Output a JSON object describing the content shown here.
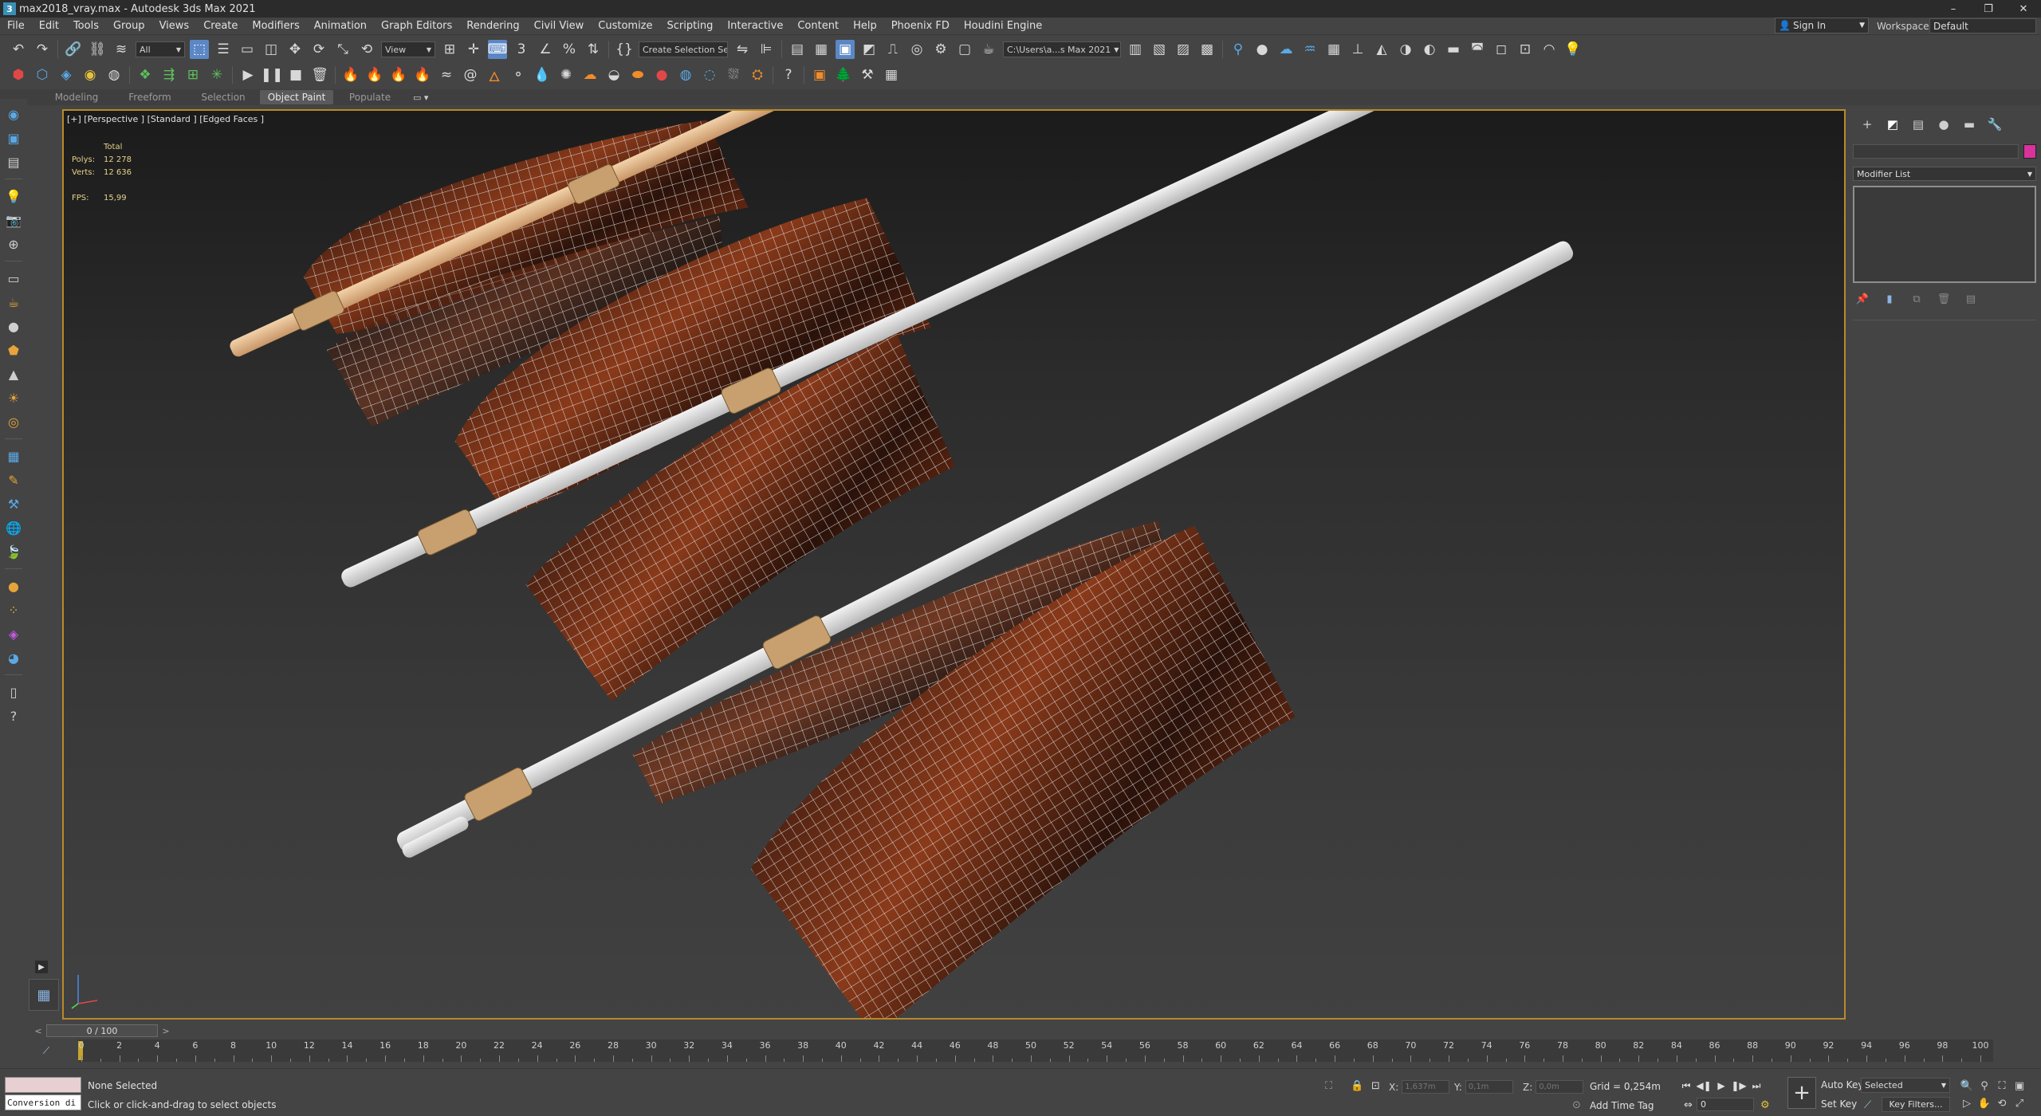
{
  "window": {
    "title": "max2018_vray.max - Autodesk 3ds Max 2021",
    "app_icon": "3",
    "controls": [
      "–",
      "❐",
      "✕"
    ]
  },
  "menu": [
    "File",
    "Edit",
    "Tools",
    "Group",
    "Views",
    "Create",
    "Modifiers",
    "Animation",
    "Graph Editors",
    "Rendering",
    "Civil View",
    "Customize",
    "Scripting",
    "Interactive",
    "Content",
    "Help",
    "Phoenix FD",
    "Houdini Engine"
  ],
  "account": {
    "signin_label": "Sign In",
    "workspaces_label": "Workspaces:",
    "workspace_value": "Default"
  },
  "toolbar1": {
    "selection_filter": "All",
    "ref_coord": "View",
    "named_selection": "Create Selection Se",
    "project_path": "C:\\Users\\a...s Max 2021"
  },
  "ribbon": {
    "tabs": [
      "Modeling",
      "Freeform",
      "Selection",
      "Object Paint",
      "Populate"
    ],
    "active": "Object Paint",
    "toggle": "▭ ▾"
  },
  "viewport": {
    "label": "[+] [Perspective ] [Standard ] [Edged Faces ]",
    "stats": {
      "header": "Total",
      "polys_label": "Polys:",
      "polys": "12 278",
      "verts_label": "Verts:",
      "verts": "12 636",
      "fps_label": "FPS:",
      "fps": "15,99"
    },
    "border_color": "#b88a2a"
  },
  "command_panel": {
    "modifier_list": "Modifier List",
    "object_color": "#d8339a"
  },
  "time_slider": {
    "prev": "<",
    "frame": "0 / 100",
    "next": ">"
  },
  "track_bar": {
    "start": 0,
    "end": 100,
    "labels": [
      "0",
      "2",
      "4",
      "6",
      "8",
      "10",
      "12",
      "14",
      "16",
      "18",
      "20",
      "22",
      "24",
      "26",
      "28",
      "30",
      "32",
      "34",
      "36",
      "38",
      "40",
      "42",
      "44",
      "46",
      "48",
      "50",
      "52",
      "54",
      "56",
      "58",
      "60",
      "62",
      "64",
      "66",
      "68",
      "70",
      "72",
      "74",
      "76",
      "78",
      "80",
      "82",
      "84",
      "86",
      "88",
      "90",
      "92",
      "94",
      "96",
      "98",
      "100"
    ]
  },
  "status": {
    "maxscript_text": "Conversion di",
    "selection": "None Selected",
    "prompt": "Click or click-and-drag to select objects",
    "x_label": "X:",
    "x_value": "1,637m",
    "y_label": "Y:",
    "y_value": "0,1m",
    "z_label": "Z:",
    "z_value": "0,0m",
    "grid": "Grid = 0,254m",
    "add_time_tag": "Add Time Tag",
    "frame_spinner": "0",
    "auto_key": "Auto Key",
    "set_key": "Set Key",
    "key_mode": "Selected",
    "key_filters": "Key Filters..."
  }
}
